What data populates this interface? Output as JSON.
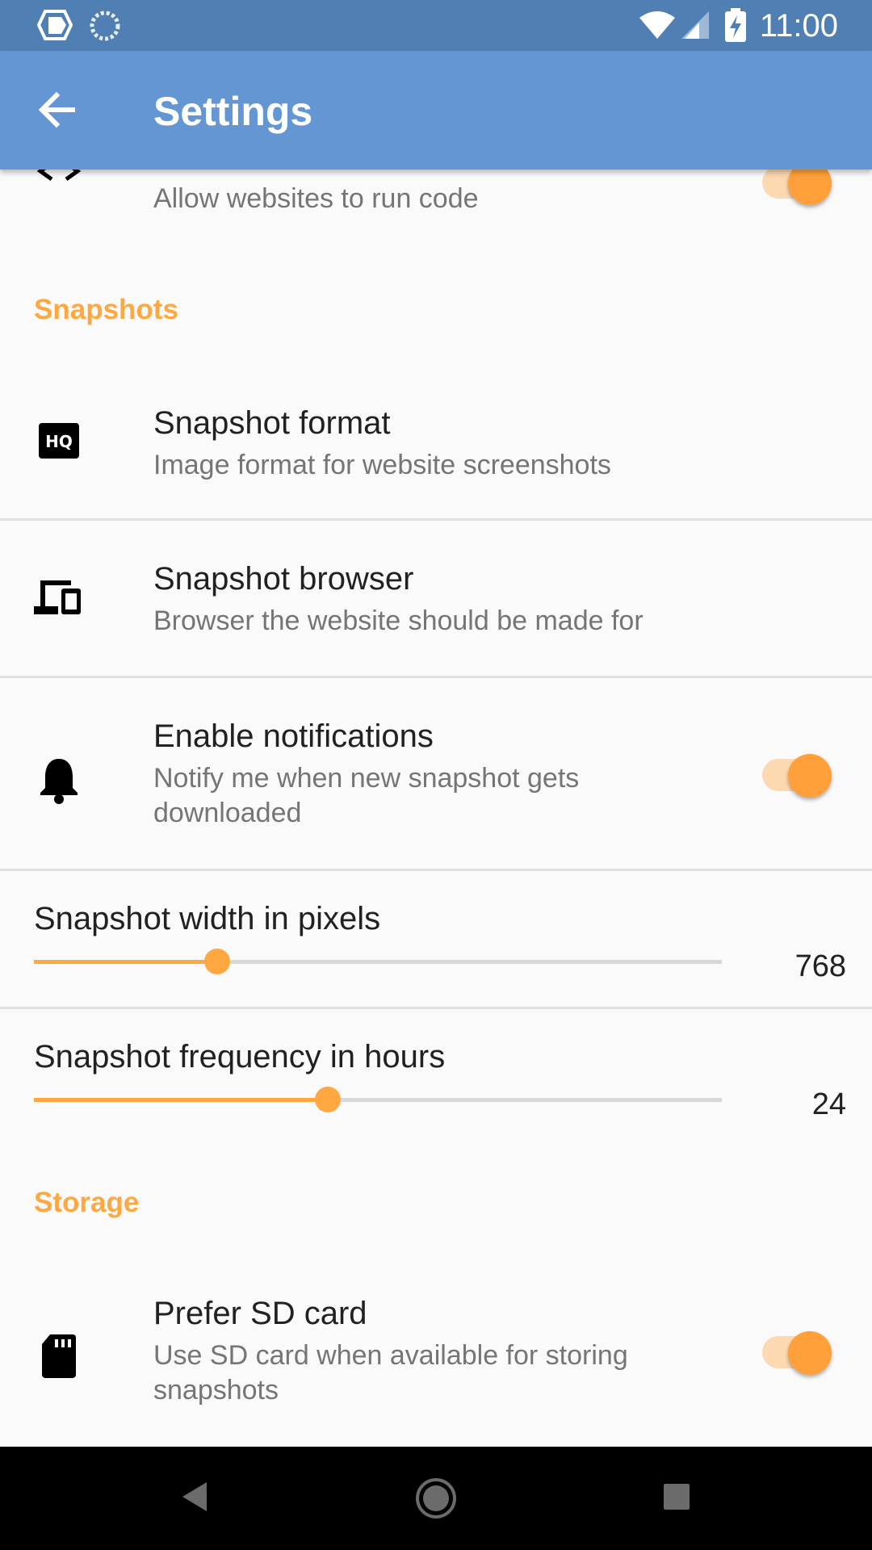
{
  "status_bar": {
    "time": "11:00"
  },
  "app_bar": {
    "title": "Settings",
    "back_icon": "arrow-back-icon"
  },
  "prefs_top": {
    "javascript_summary": "Allow websites to run code",
    "javascript_icon": "code-brackets-icon",
    "javascript_enabled": true
  },
  "sections": {
    "snapshots": "Snapshots",
    "storage": "Storage"
  },
  "snapshot_format": {
    "title": "Snapshot format",
    "summary": "Image format for website screenshots",
    "icon": "hq-icon"
  },
  "snapshot_browser": {
    "title": "Snapshot browser",
    "summary": "Browser the website should be made for",
    "icon": "devices-icon"
  },
  "notifications": {
    "title": "Enable notifications",
    "summary": "Notify me when new snapshot gets downloaded",
    "icon": "bell-icon",
    "enabled": true
  },
  "snapshot_width": {
    "title": "Snapshot width in pixels",
    "value": "768",
    "fraction": 0.266
  },
  "snapshot_frequency": {
    "title": "Snapshot frequency in hours",
    "value": "24",
    "fraction": 0.427
  },
  "sd_card": {
    "title": "Prefer SD card",
    "summary": "Use SD card when available for storing snapshots",
    "icon": "sd-card-icon",
    "enabled": true
  },
  "colors": {
    "status_bar": "#4f7fb3",
    "app_bar": "#6396d3",
    "accent": "#ffa842"
  }
}
